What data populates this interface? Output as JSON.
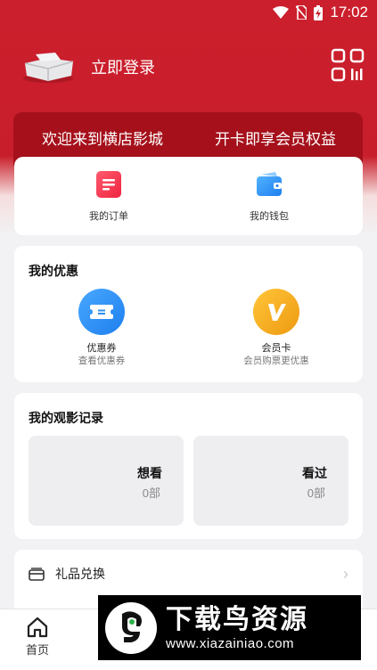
{
  "status_bar": {
    "time": "17:02"
  },
  "header": {
    "login_text": "立即登录"
  },
  "banner": {
    "left": "欢迎来到横店影城",
    "right": "开卡即享会员权益"
  },
  "quick_links": [
    {
      "label": "我的订单",
      "icon": "order-icon"
    },
    {
      "label": "我的钱包",
      "icon": "wallet-icon"
    }
  ],
  "promotions": {
    "title": "我的优惠",
    "items": [
      {
        "label": "优惠券",
        "sub": "查看优惠券",
        "icon": "ticket-icon",
        "color": "#2b8ff0"
      },
      {
        "label": "会员卡",
        "sub": "会员购票更优惠",
        "icon": "v-icon",
        "color": "#f2a81c"
      }
    ]
  },
  "history": {
    "title": "我的观影记录",
    "items": [
      {
        "label": "想看",
        "count": "0部"
      },
      {
        "label": "看过",
        "count": "0部"
      }
    ]
  },
  "list": {
    "gift_exchange": "礼品兑换"
  },
  "tabbar": {
    "home": "首页"
  },
  "watermark": {
    "title": "下载鸟资源",
    "url": "www.xiazainiao.com"
  },
  "colors": {
    "brand_red": "#c81e2b",
    "banner_red": "#a5101b"
  }
}
